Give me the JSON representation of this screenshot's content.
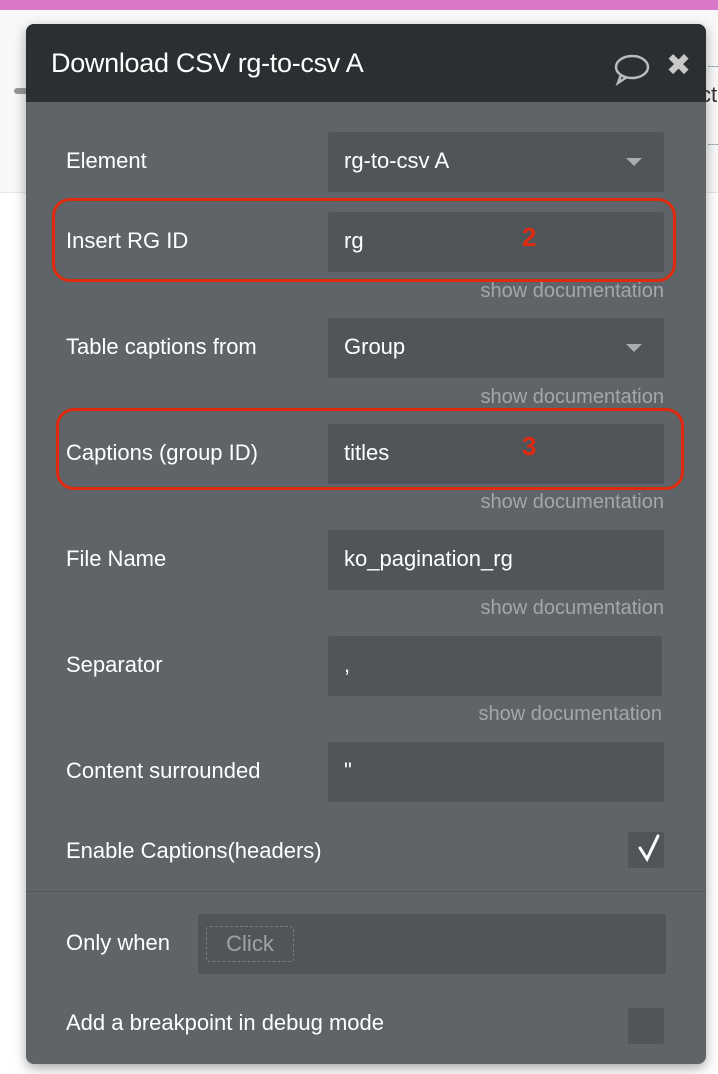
{
  "background": {
    "partial_text": "ct"
  },
  "dialog": {
    "title": "Download CSV rg-to-csv A",
    "icons": {
      "comment": "speech-bubble-icon",
      "close": "close-x-icon"
    },
    "fields": [
      {
        "label": "Element",
        "value": "rg-to-csv A",
        "type": "dropdown"
      },
      {
        "label": "Insert RG ID",
        "value": "rg",
        "type": "text",
        "doc": "show documentation"
      },
      {
        "label": "Table captions from",
        "value": "Group",
        "type": "dropdown",
        "doc": "show documentation"
      },
      {
        "label": "Captions (group ID)",
        "value": "titles",
        "type": "text",
        "doc": "show documentation"
      },
      {
        "label": "File Name",
        "value": "ko_pagination_rg",
        "type": "text",
        "doc": "show documentation"
      },
      {
        "label": "Separator",
        "value": ",",
        "type": "text",
        "doc": "show documentation"
      },
      {
        "label": "Content surrounded",
        "value": "\"",
        "type": "text"
      }
    ],
    "enable_captions": {
      "label": "Enable Captions(headers)",
      "checked": true
    },
    "only_when": {
      "label": "Only when",
      "placeholder": "Click"
    },
    "breakpoint": {
      "label": "Add a breakpoint in debug mode",
      "checked": false
    }
  },
  "annotations": {
    "step2": "2",
    "step3": "3",
    "color": "#e02a10"
  }
}
